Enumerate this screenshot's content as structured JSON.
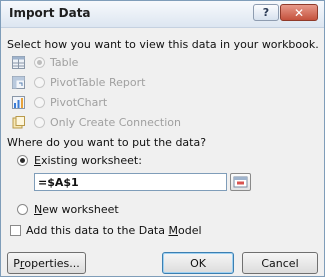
{
  "window": {
    "title": "Import Data",
    "help_glyph": "?",
    "close_glyph": "✕"
  },
  "view_section": {
    "heading": "Select how you want to view this data in your workbook.",
    "options": [
      {
        "label": "Table",
        "icon": "table-icon",
        "selected": true,
        "enabled": false
      },
      {
        "label": "PivotTable Report",
        "icon": "pivottable-icon",
        "selected": false,
        "enabled": false
      },
      {
        "label": "PivotChart",
        "icon": "pivotchart-icon",
        "selected": false,
        "enabled": false
      },
      {
        "label": "Only Create Connection",
        "icon": "connection-icon",
        "selected": false,
        "enabled": false
      }
    ]
  },
  "location_section": {
    "heading": "Where do you want to put the data?",
    "existing_prefix": "",
    "existing_accel": "E",
    "existing_rest": "xisting worksheet:",
    "existing_selected": true,
    "reference_value": "=$A$1",
    "new_accel": "N",
    "new_rest": "ew worksheet",
    "new_selected": false
  },
  "data_model": {
    "label_before": "Add this data to the Data ",
    "label_accel": "M",
    "label_after": "odel",
    "checked": false
  },
  "buttons": {
    "properties_prefix": "P",
    "properties_accel": "r",
    "properties_rest": "operties...",
    "ok": "OK",
    "cancel": "Cancel"
  },
  "colors": {
    "accent": "#3c7fb1",
    "disabled_text": "#a0a0a0",
    "dialog_bg": "#f0f0f0"
  }
}
